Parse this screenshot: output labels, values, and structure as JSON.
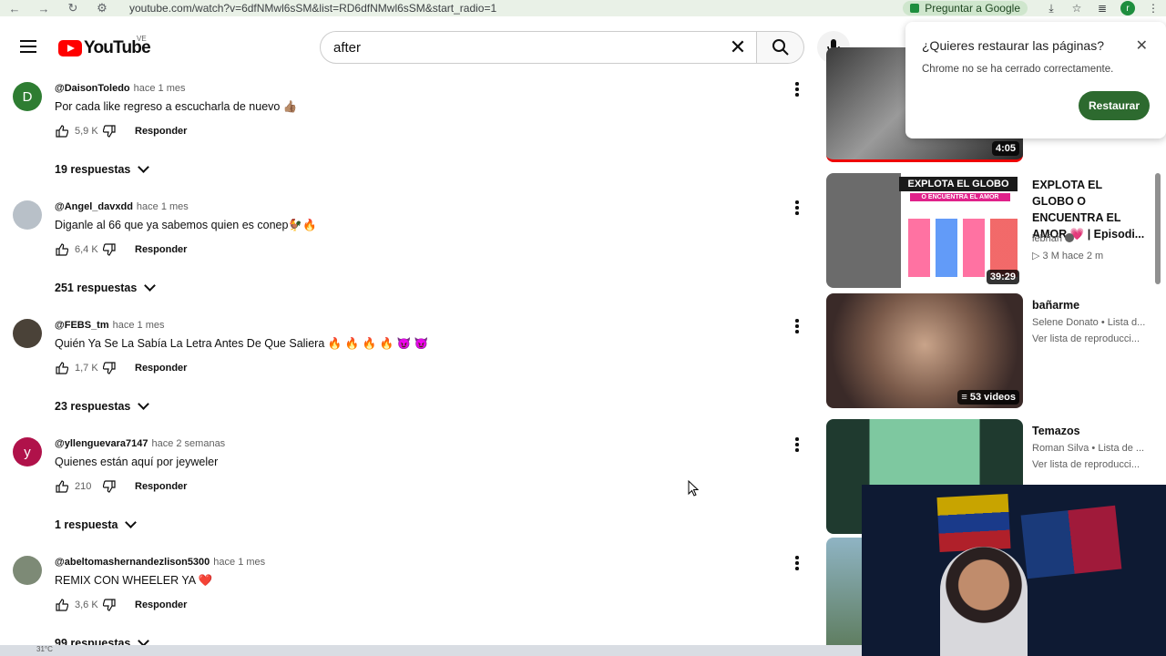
{
  "browser": {
    "url": "youtube.com/watch?v=6dfNMwl6sSM&list=RD6dfNMwl6sSM&start_radio=1",
    "ask_google": "Preguntar a Google",
    "profile_initial": "r"
  },
  "header": {
    "logo_text": "YouTube",
    "country_code": "VE",
    "search_value": "after"
  },
  "comments": [
    {
      "handle": "@DaisonToledo",
      "time": "hace 1 mes",
      "text": "Por cada like regreso a escucharla de nuevo 👍🏽",
      "likes": "5,9 K",
      "reply": "Responder",
      "replies": "19 respuestas",
      "avatar_letter": "D",
      "avatar_color": "#2e7d32"
    },
    {
      "handle": "@Angel_davxdd",
      "time": "hace 1 mes",
      "text": "Diganle al 66 que ya sabemos quien es conep🐓🔥",
      "likes": "6,4 K",
      "reply": "Responder",
      "replies": "251 respuestas",
      "avatar_letter": "",
      "avatar_color": "#9aa3ad"
    },
    {
      "handle": "@FEBS_tm",
      "time": "hace 1 mes",
      "text": "Quién Ya Se La Sabía La Letra Antes De Que Saliera 🔥 🔥 🔥 🔥 😈 😈",
      "likes": "1,7 K",
      "reply": "Responder",
      "replies": "23 respuestas",
      "avatar_letter": "",
      "avatar_color": "#4a4238"
    },
    {
      "handle": "@yllenguevara7147",
      "time": "hace 2 semanas",
      "text": "Quienes están aquí por jeyweler",
      "likes": "210",
      "reply": "Responder",
      "replies": "1 respuesta",
      "avatar_letter": "y",
      "avatar_color": "#b0124a"
    },
    {
      "handle": "@abeltomashernandezlison5300",
      "time": "hace 1 mes",
      "text": "REMIX CON WHEELER YA ❤️",
      "likes": "3,6 K",
      "reply": "Responder",
      "replies": "99 respuestas",
      "avatar_letter": "",
      "avatar_color": "#7d8a76"
    }
  ],
  "sidebar": {
    "cards": [
      {
        "title": "",
        "sub1": "",
        "sub2": "",
        "duration": "4:05"
      },
      {
        "title": "EXPLOTA EL GLOBO O ENCUENTRA EL AMOR 💗 | Episodi...",
        "sub1": "lebriah",
        "sub2": "3 M  hace 2 m",
        "duration": "39:29",
        "thumb_text": "EXPLOTA EL GLOBO",
        "thumb_sub": "O ENCUENTRA EL AMOR"
      },
      {
        "title": "bañarme",
        "sub1": "Selene Donato • Lista d...",
        "sub2": "Ver lista de reproducci...",
        "duration": "53 videos"
      },
      {
        "title": "Temazos",
        "sub1": "Roman Silva • Lista de ...",
        "sub2": "Ver lista de reproducci...",
        "duration": ""
      }
    ]
  },
  "popup": {
    "title": "¿Quieres restaurar las páginas?",
    "body": "Chrome no se ha cerrado correctamente.",
    "button": "Restaurar"
  },
  "taskbar": {
    "temp": "31°C"
  }
}
